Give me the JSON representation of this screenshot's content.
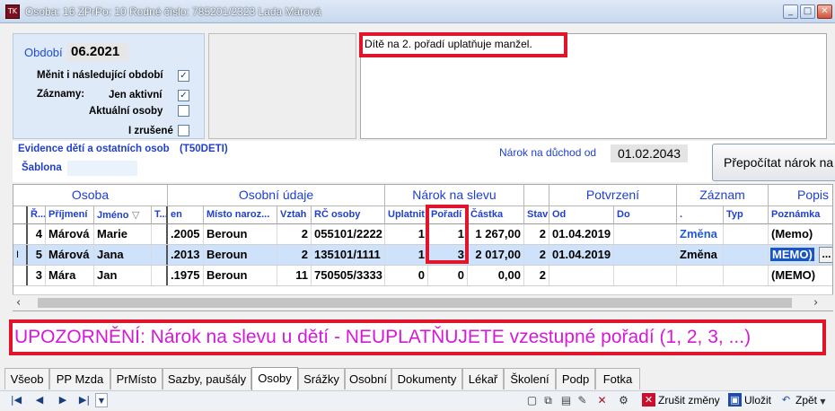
{
  "window": {
    "icon_text": "TK",
    "title": "Osoba: 16   ZPrPo: 10     Rodné číslo: 785201/2323    Lada Márová",
    "minimize": "_",
    "maximize": "□",
    "close": "✕"
  },
  "period": {
    "label": "Období",
    "value": "06.2021",
    "change_following_label": "Měnit i následující období",
    "records_label": "Záznamy:",
    "only_active_label": "Jen aktivní",
    "current_persons_label": "Aktuální osoby",
    "cancelled_label": "I zrušené",
    "change_following": true,
    "only_active": true,
    "current_persons": false,
    "cancelled": false
  },
  "memo": {
    "text": "Dítě na 2. pořadí uplatňuje manžel."
  },
  "evidence": {
    "title": "Evidence dětí a ostatních osob",
    "code": "(T50DETI)",
    "template_label": "Šablona",
    "template_value": "",
    "pension_label": "Nárok na důchod od",
    "pension_value": "01.02.2043",
    "recalc_button": "Přepočítat nárok na slevu"
  },
  "grid": {
    "bands": [
      "Osoba",
      "Osobní údaje",
      "Nárok na slevu",
      "Potvrzení",
      "Záznam",
      "Popis"
    ],
    "columns": [
      "Ř...",
      "Příjmení",
      "Jméno",
      "T...",
      "en",
      "Místo naroz...",
      "Vztah",
      "RČ osoby",
      "Uplatnit",
      "Pořadí",
      "Částka",
      "Stav",
      "Od",
      "Do",
      ".",
      "Typ",
      "Poznámka"
    ],
    "rows": [
      {
        "r": "4",
        "prijmeni": "Márová",
        "jmeno": "Marie",
        "t": "",
        "narozen": ".2005",
        "misto": "Beroun",
        "vztah": "2",
        "rc": "055101/2222",
        "uplatnit": "1",
        "poradi": "1",
        "castka": "1 267,00",
        "stav": "2",
        "od": "01.04.2019",
        "do": "",
        "zmena": "Změna",
        "typ": "",
        "poznamka": "(Memo)"
      },
      {
        "r": "5",
        "prijmeni": "Márová",
        "jmeno": "Jana",
        "t": "",
        "narozen": ".2013",
        "misto": "Beroun",
        "vztah": "2",
        "rc": "135101/1111",
        "uplatnit": "1",
        "poradi": "3",
        "castka": "2 017,00",
        "stav": "2",
        "od": "01.04.2019",
        "do": "",
        "zmena": "Změna",
        "typ": "",
        "poznamka": "MEMO)"
      },
      {
        "r": "3",
        "prijmeni": "Mára",
        "jmeno": "Jan",
        "t": "",
        "narozen": ".1975",
        "misto": "Beroun",
        "vztah": "11",
        "rc": "750505/3333",
        "uplatnit": "0",
        "poradi": "0",
        "castka": "0,00",
        "stav": "2",
        "od": "",
        "do": "",
        "zmena": "",
        "typ": "",
        "poznamka": "(MEMO)"
      }
    ],
    "row_indicator": "I",
    "ellipsis": "..."
  },
  "warning": {
    "text": "UPOZORNĚNÍ:  Nárok na slevu u dětí -  NEUPLATŇUJETE vzestupné pořadí (1, 2, 3, ...)"
  },
  "tabs": [
    "Všeob",
    "PP Mzda",
    "PrMísto",
    "Sazby, paušály",
    "Osoby",
    "Srážky",
    "Osobní",
    "Dokumenty",
    "Lékař",
    "Školení",
    "Podp",
    "Fotka"
  ],
  "active_tab": "Osoby",
  "toolbar": {
    "first": "|◀",
    "prev": "◀",
    "next": "▶",
    "last": "▶|",
    "cancel_changes": "Zrušit změny",
    "save": "Uložit",
    "back": "Zpět"
  }
}
